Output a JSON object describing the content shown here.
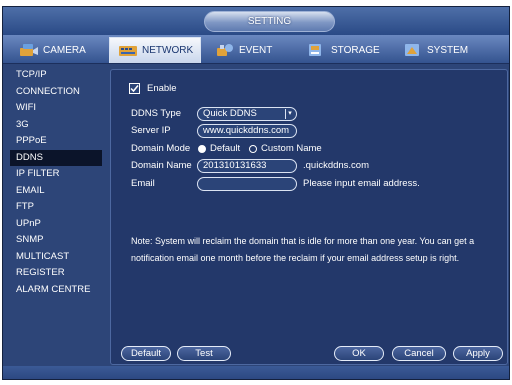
{
  "window": {
    "title": "SETTING"
  },
  "tabs": [
    {
      "label": "CAMERA",
      "icon": "camera-icon"
    },
    {
      "label": "NETWORK",
      "icon": "network-icon"
    },
    {
      "label": "EVENT",
      "icon": "event-icon"
    },
    {
      "label": "STORAGE",
      "icon": "storage-icon"
    },
    {
      "label": "SYSTEM",
      "icon": "system-icon"
    }
  ],
  "active_tab": "NETWORK",
  "sidebar": {
    "items": [
      "TCP/IP",
      "CONNECTION",
      "WIFI",
      "3G",
      "PPPoE",
      "DDNS",
      "IP FILTER",
      "EMAIL",
      "FTP",
      "UPnP",
      "SNMP",
      "MULTICAST",
      "REGISTER",
      "ALARM CENTRE"
    ],
    "active": "DDNS"
  },
  "form": {
    "enable_label": "Enable",
    "enabled": true,
    "ddns_type_label": "DDNS Type",
    "ddns_type_value": "Quick DDNS",
    "server_ip_label": "Server IP",
    "server_ip_value": "www.quickddns.com",
    "domain_mode_label": "Domain Mode",
    "domain_mode_default": "Default",
    "domain_mode_custom": "Custom Name",
    "domain_mode_selected": "Default",
    "domain_name_label": "Domain Name",
    "domain_name_value": "201310131633",
    "domain_suffix": ".quickddns.com",
    "email_label": "Email",
    "email_value": "",
    "email_hint": "Please input email address."
  },
  "note": "Note: System will reclaim the domain that is idle for more than one year. You can get a notification email one month before the reclaim if your email address setup is right.",
  "buttons": {
    "default": "Default",
    "test": "Test",
    "ok": "OK",
    "cancel": "Cancel",
    "apply": "Apply"
  },
  "colors": {
    "background": "#2d4578",
    "panel": "#23386a",
    "active_tab": "#c9d6ec",
    "active_sidebar": "#0b142a"
  }
}
